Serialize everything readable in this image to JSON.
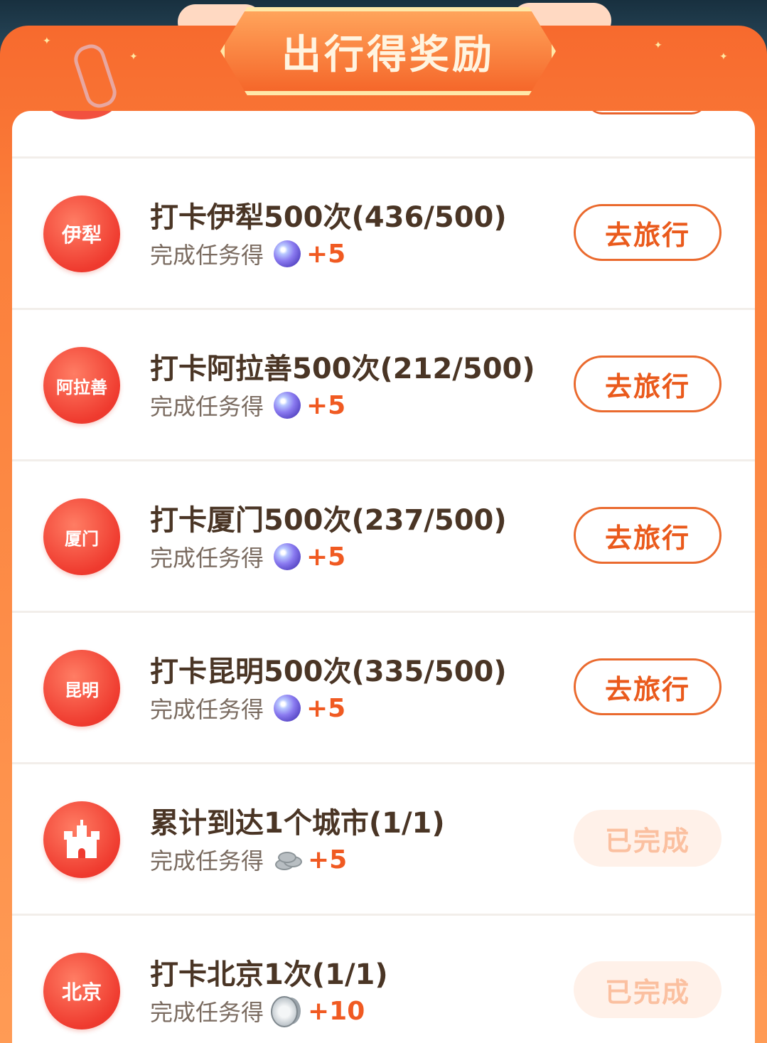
{
  "header": {
    "title": "出行得奖励"
  },
  "tasks": [
    {
      "icon_label": "伊犁",
      "title": "打卡伊犁500次(436/500)",
      "reward_prefix": "完成任务得",
      "reward_icon": "gem-icon",
      "reward_value": "+5",
      "button_label": "去旅行",
      "completed": false
    },
    {
      "icon_label": "阿拉善",
      "title": "打卡阿拉善500次(212/500)",
      "reward_prefix": "完成任务得",
      "reward_icon": "gem-icon",
      "reward_value": "+5",
      "button_label": "去旅行",
      "completed": false
    },
    {
      "icon_label": "厦门",
      "title": "打卡厦门500次(237/500)",
      "reward_prefix": "完成任务得",
      "reward_icon": "gem-icon",
      "reward_value": "+5",
      "button_label": "去旅行",
      "completed": false
    },
    {
      "icon_label": "昆明",
      "title": "打卡昆明500次(335/500)",
      "reward_prefix": "完成任务得",
      "reward_icon": "gem-icon",
      "reward_value": "+5",
      "button_label": "去旅行",
      "completed": false
    },
    {
      "icon_name": "castle-icon",
      "title": "累计到达1个城市(1/1)",
      "reward_prefix": "完成任务得",
      "reward_icon": "silver-coins-icon",
      "reward_value": "+5",
      "button_label": "已完成",
      "completed": true
    },
    {
      "icon_label": "北京",
      "title": "打卡北京1次(1/1)",
      "reward_prefix": "完成任务得",
      "reward_icon": "silver-coin-icon",
      "reward_value": "+10",
      "button_label": "已完成",
      "completed": true
    }
  ],
  "colors": {
    "panel_orange": "#f76a2e",
    "accent_text": "#f05a22",
    "title_text": "#4a3525",
    "done_button_bg": "#fff1e9"
  }
}
